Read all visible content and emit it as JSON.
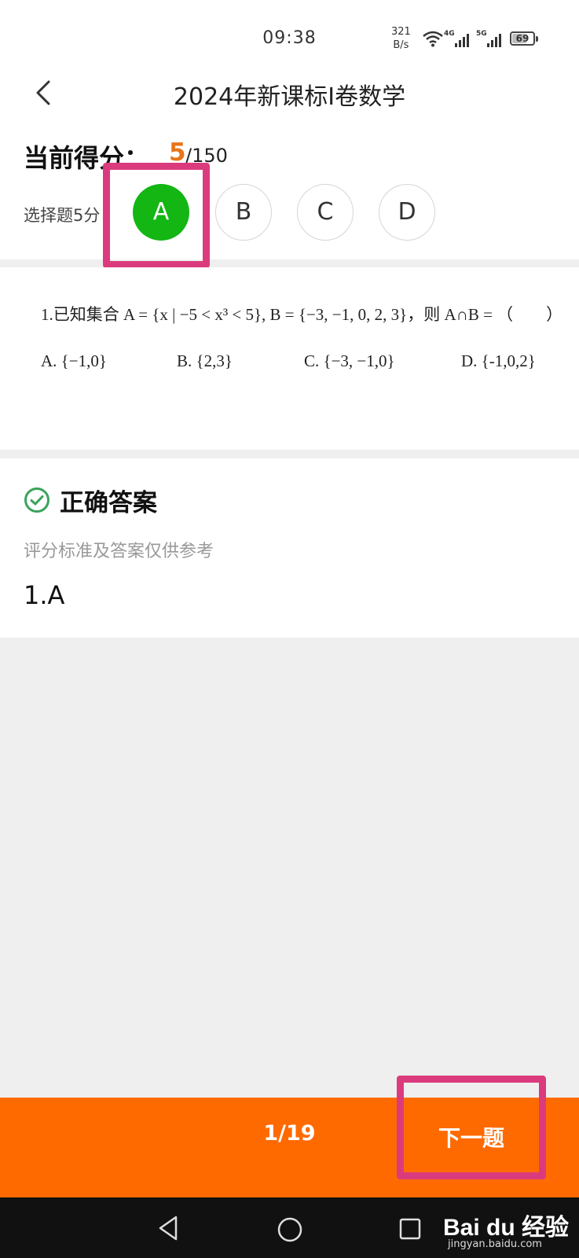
{
  "status_bar": {
    "time": "09:38",
    "net_speed_value": "321",
    "net_speed_unit": "B/s",
    "network_1": "4G",
    "network_2": "5G",
    "battery": "69"
  },
  "header": {
    "title": "2024年新课标I卷数学"
  },
  "score": {
    "label": "当前得分：",
    "value": "5",
    "total": "/150"
  },
  "question_type": "选择题5分",
  "options": [
    {
      "label": "A",
      "selected": true
    },
    {
      "label": "B",
      "selected": false
    },
    {
      "label": "C",
      "selected": false
    },
    {
      "label": "D",
      "selected": false
    }
  ],
  "question": {
    "stem": "1.已知集合 A = {x | −5 < x³ < 5}, B = {−3, −1, 0, 2, 3}，则 A∩B = （　　）",
    "choices": [
      "A. {−1,0}",
      "B. {2,3}",
      "C. {−3, −1,0}",
      "D. {-1,0,2}"
    ]
  },
  "answer": {
    "heading": "正确答案",
    "note": "评分标准及答案仅供参考",
    "value": "1.A"
  },
  "bottom_bar": {
    "page": "1/19",
    "next_label": "下一题"
  },
  "watermark": {
    "brand": "Bai du 经验",
    "url": "jingyan.baidu.com"
  },
  "colors": {
    "accent_orange": "#ff6a00",
    "selected_green": "#13b613",
    "score_orange": "#e8751a",
    "highlight_pink": "#db3b7d",
    "check_green": "#3aa35a"
  }
}
